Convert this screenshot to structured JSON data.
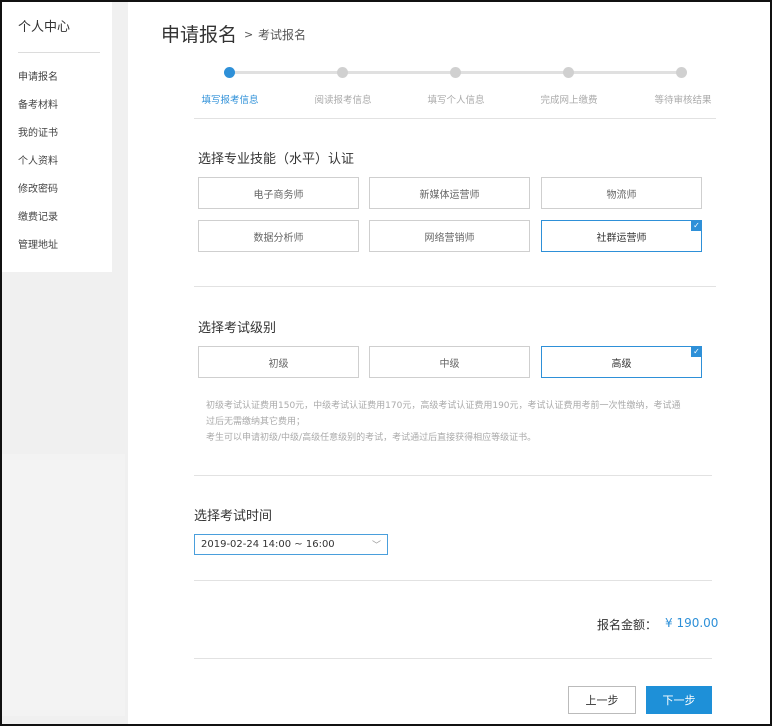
{
  "sidebar": {
    "title": "个人中心",
    "items": [
      {
        "label": "申请报名"
      },
      {
        "label": "备考材料"
      },
      {
        "label": "我的证书"
      },
      {
        "label": "个人资料"
      },
      {
        "label": "修改密码"
      },
      {
        "label": "缴费记录"
      },
      {
        "label": "管理地址"
      }
    ]
  },
  "header": {
    "title": "申请报名",
    "separator": ">",
    "subtitle": "考试报名"
  },
  "steps": [
    {
      "label": "填写报考信息",
      "active": true
    },
    {
      "label": "阅读报考信息",
      "active": false
    },
    {
      "label": "填写个人信息",
      "active": false
    },
    {
      "label": "完成网上缴费",
      "active": false
    },
    {
      "label": "等待审核结果",
      "active": false
    }
  ],
  "skill_section": {
    "title": "选择专业技能（水平）认证",
    "options": [
      {
        "label": "电子商务师",
        "selected": false
      },
      {
        "label": "新媒体运营师",
        "selected": false
      },
      {
        "label": "物流师",
        "selected": false
      },
      {
        "label": "数据分析师",
        "selected": false
      },
      {
        "label": "网络营销师",
        "selected": false
      },
      {
        "label": "社群运营师",
        "selected": true
      }
    ]
  },
  "level_section": {
    "title": "选择考试级别",
    "options": [
      {
        "label": "初级",
        "selected": false
      },
      {
        "label": "中级",
        "selected": false
      },
      {
        "label": "高级",
        "selected": true
      }
    ],
    "notes": [
      "初级考试认证费用150元，中级考试认证费用170元，高级考试认证费用190元，考试认证费用考前一次性缴纳，考试通",
      "过后无需缴纳其它费用；",
      "考生可以申请初级/中级/高级任意级别的考试，考试通过后直接获得相应等级证书。"
    ]
  },
  "time_section": {
    "title": "选择考试时间",
    "selected_value": "2019-02-24 14:00 ~ 16:00"
  },
  "total": {
    "label": "报名金额：",
    "value": "¥ 190.00"
  },
  "buttons": {
    "prev": "上一步",
    "next": "下一步"
  },
  "colors": {
    "accent": "#2e90d8",
    "border": "#cfcfcf"
  }
}
